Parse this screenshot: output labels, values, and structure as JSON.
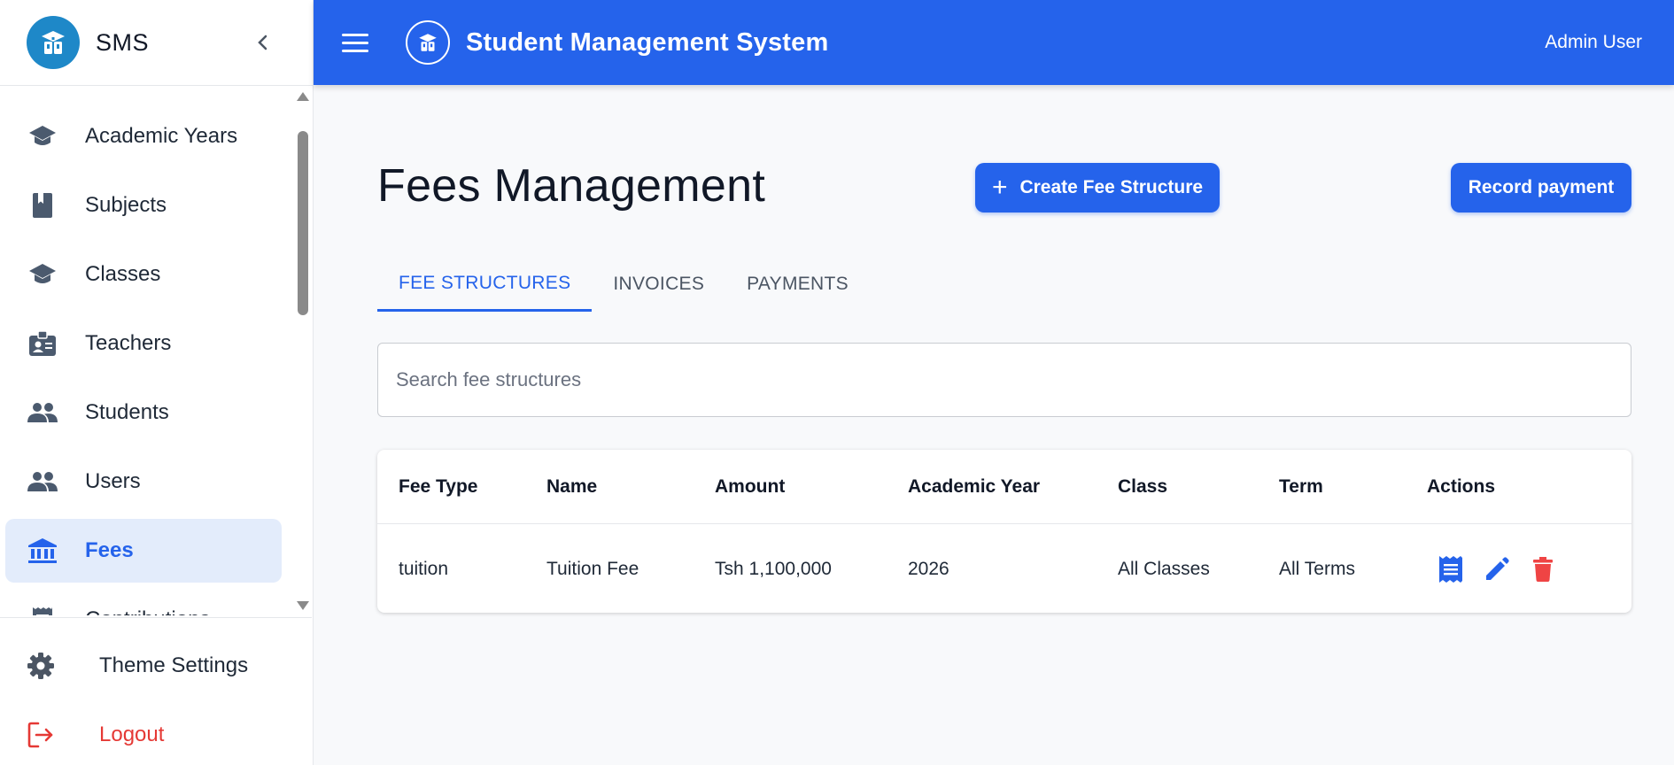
{
  "sidebar": {
    "brand": "SMS",
    "items": [
      {
        "label": "Academic Years",
        "icon": "graduation-cap-icon"
      },
      {
        "label": "Subjects",
        "icon": "book-icon"
      },
      {
        "label": "Classes",
        "icon": "graduation-cap-icon"
      },
      {
        "label": "Teachers",
        "icon": "id-badge-icon"
      },
      {
        "label": "Students",
        "icon": "people-icon"
      },
      {
        "label": "Users",
        "icon": "people-icon"
      },
      {
        "label": "Fees",
        "icon": "bank-icon",
        "active": true
      },
      {
        "label": "Contributions",
        "icon": "receipt-icon"
      }
    ],
    "theme_settings": "Theme Settings",
    "logout": "Logout"
  },
  "header": {
    "title": "Student Management System",
    "user": "Admin User"
  },
  "main": {
    "title": "Fees Management",
    "create_button": "Create Fee Structure",
    "record_button": "Record payment",
    "tabs": [
      "FEE STRUCTURES",
      "INVOICES",
      "PAYMENTS"
    ],
    "active_tab": "FEE STRUCTURES",
    "search_placeholder": "Search fee structures",
    "search_value": "",
    "table": {
      "columns": [
        "Fee Type",
        "Name",
        "Amount",
        "Academic Year",
        "Class",
        "Term",
        "Actions"
      ],
      "rows": [
        {
          "fee_type": "tuition",
          "name": "Tuition Fee",
          "amount": "Tsh 1,100,000",
          "academic_year": "2026",
          "class": "All Classes",
          "term": "All Terms"
        }
      ]
    }
  },
  "colors": {
    "primary": "#2563eb",
    "danger": "#ef4444",
    "active_bg": "#e3ecfb",
    "logo_bg": "#1e88c8"
  }
}
